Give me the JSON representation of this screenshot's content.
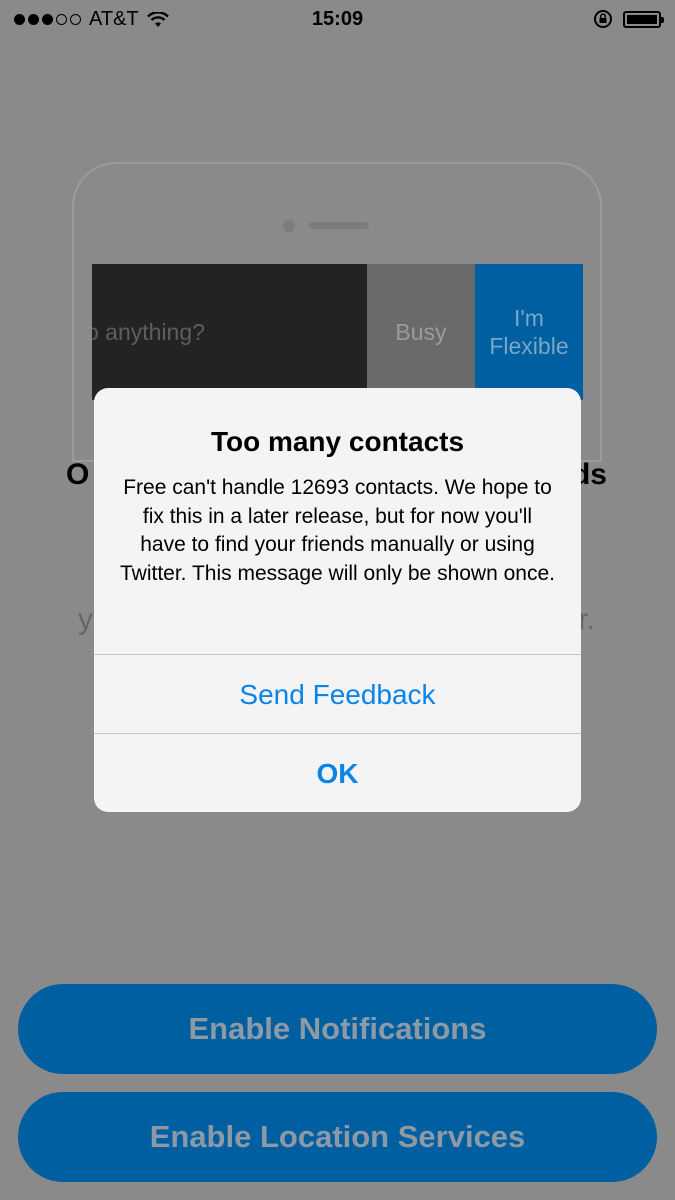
{
  "status_bar": {
    "carrier": "AT&T",
    "time": "15:09",
    "signal_bars_filled": 3,
    "signal_bars_total": 5,
    "icons": [
      "wifi-icon",
      "rotation-lock-icon",
      "battery-icon"
    ]
  },
  "background": {
    "preview": {
      "question_text": "o anything?",
      "busy_label": "Busy",
      "flexible_label_line1": "I'm",
      "flexible_label_line2": "Flexible"
    },
    "heading_left": "O",
    "heading_right": "ds",
    "text_left": "y",
    "text_right": "r."
  },
  "buttons": {
    "notifications": "Enable Notifications",
    "location": "Enable Location Services"
  },
  "alert": {
    "title": "Too many contacts",
    "message": "Free can't handle 12693 contacts. We hope to fix this in a later release, but for now you'll have to find your friends manually or using Twitter. This message will only be shown once.",
    "send_feedback": "Send Feedback",
    "ok": "OK"
  },
  "colors": {
    "dim_background": "#8a8a8a",
    "primary_button": "#005fa0",
    "alert_action": "#0a84e8",
    "alert_background": "#f4f4f4"
  }
}
